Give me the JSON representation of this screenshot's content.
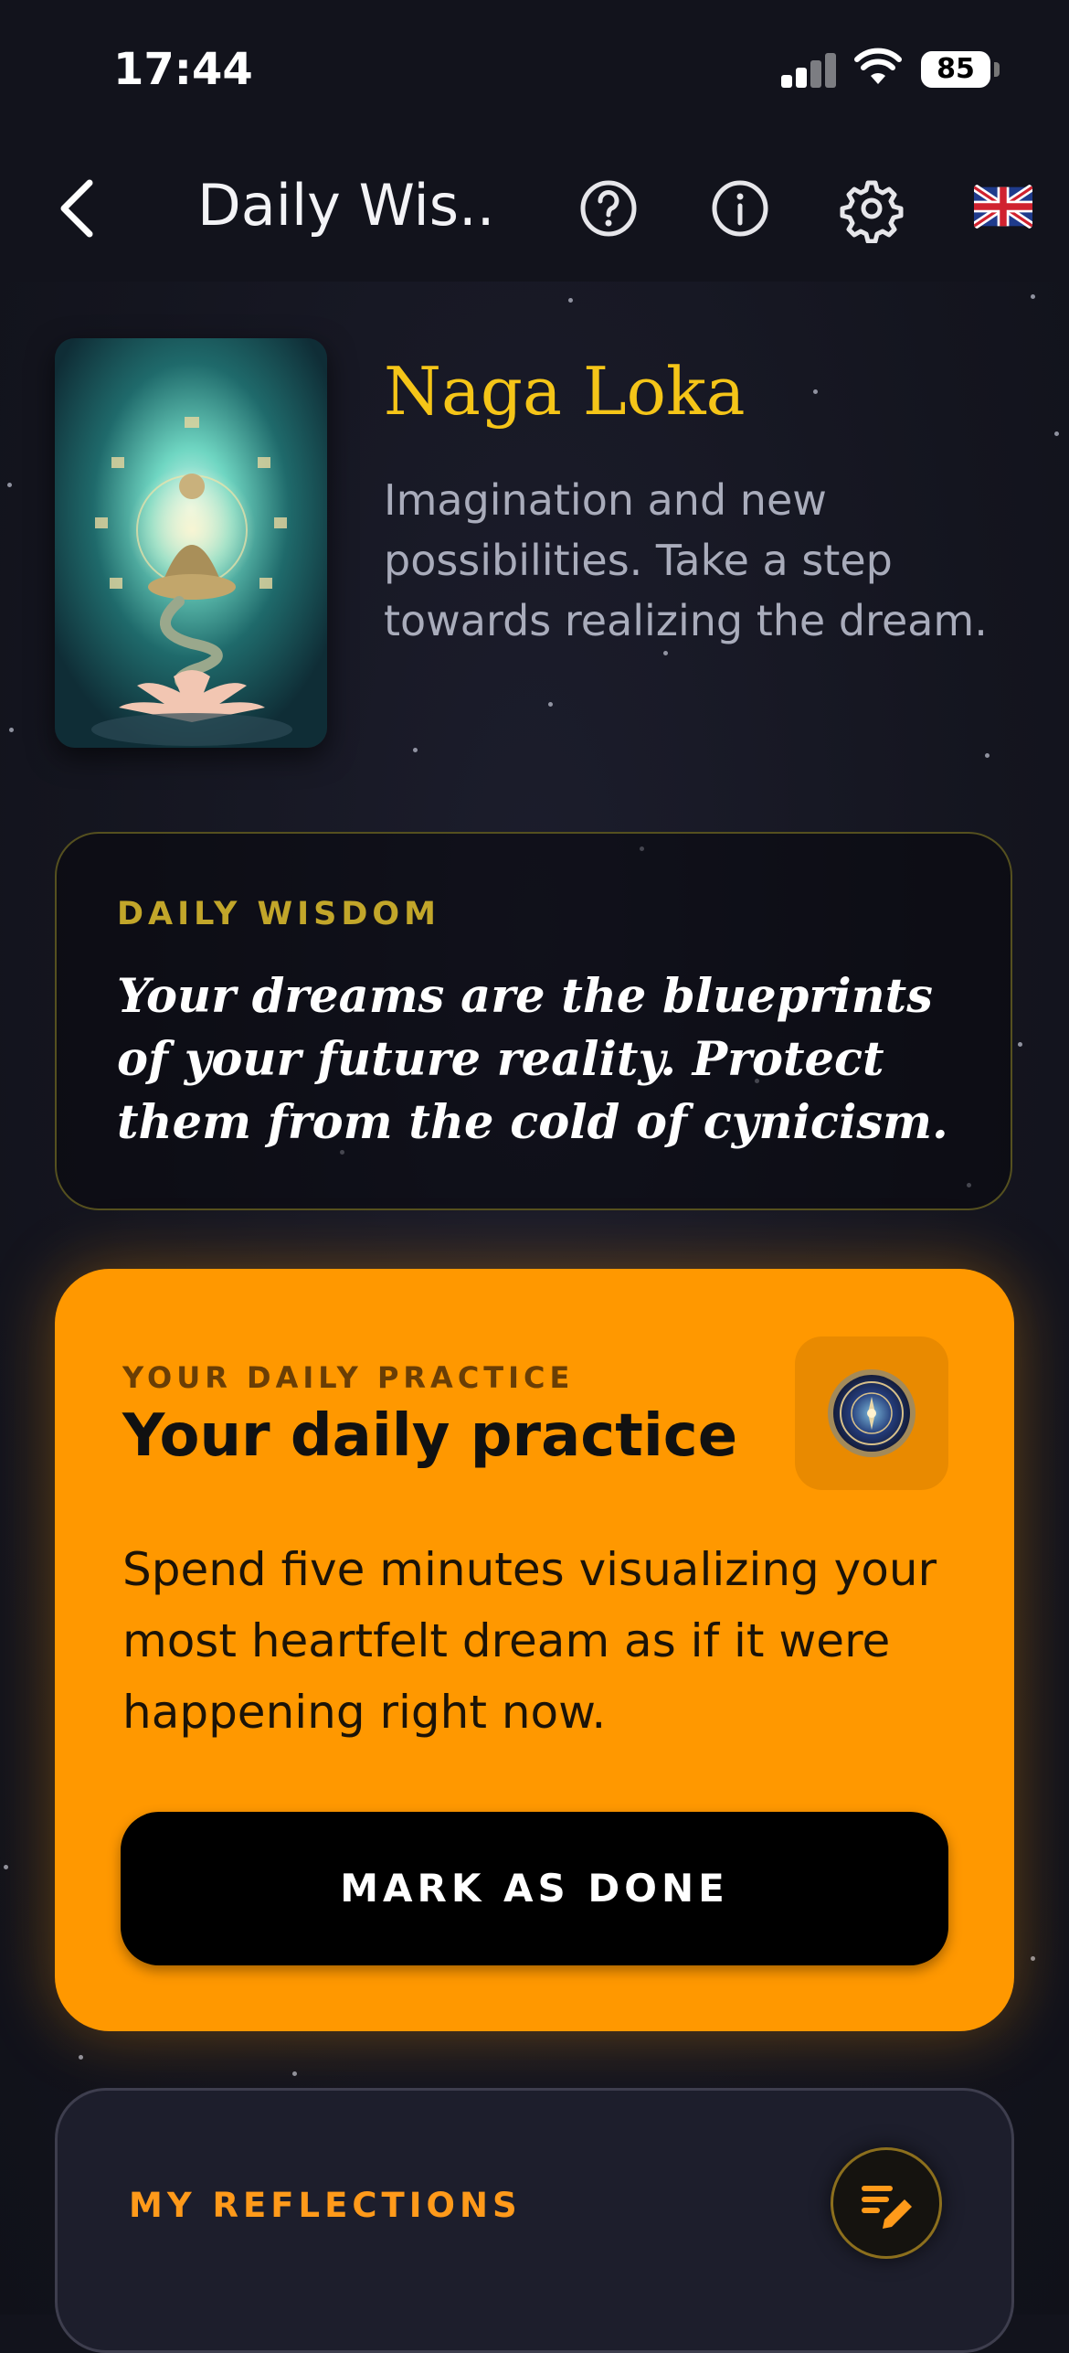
{
  "status_bar": {
    "time": "17:44",
    "battery": "85"
  },
  "nav": {
    "title": "Daily Wis..."
  },
  "card": {
    "name": "Naga Loka",
    "subtitle": "Imagination and new possibilities. Take a step towards realizing the dream."
  },
  "wisdom": {
    "label": "DAILY WISDOM",
    "quote": "Your dreams are the blueprints of your future reality. Protect them from the cold of cynicism."
  },
  "practice": {
    "label": "YOUR DAILY PRACTICE",
    "title": "Your daily practice",
    "description": "Spend five minutes visualizing your most heartfelt dream as if it were happening right now.",
    "button_label": "MARK AS DONE"
  },
  "reflections": {
    "label": "MY REFLECTIONS"
  },
  "colors": {
    "accent": "#ff9800",
    "title_gold": "#f5c518",
    "background": "#14151f"
  },
  "icons": [
    "back-chevron-icon",
    "help-icon",
    "info-icon",
    "gear-icon",
    "uk-flag-icon",
    "meditation-medallion-icon",
    "edit-notes-icon"
  ]
}
